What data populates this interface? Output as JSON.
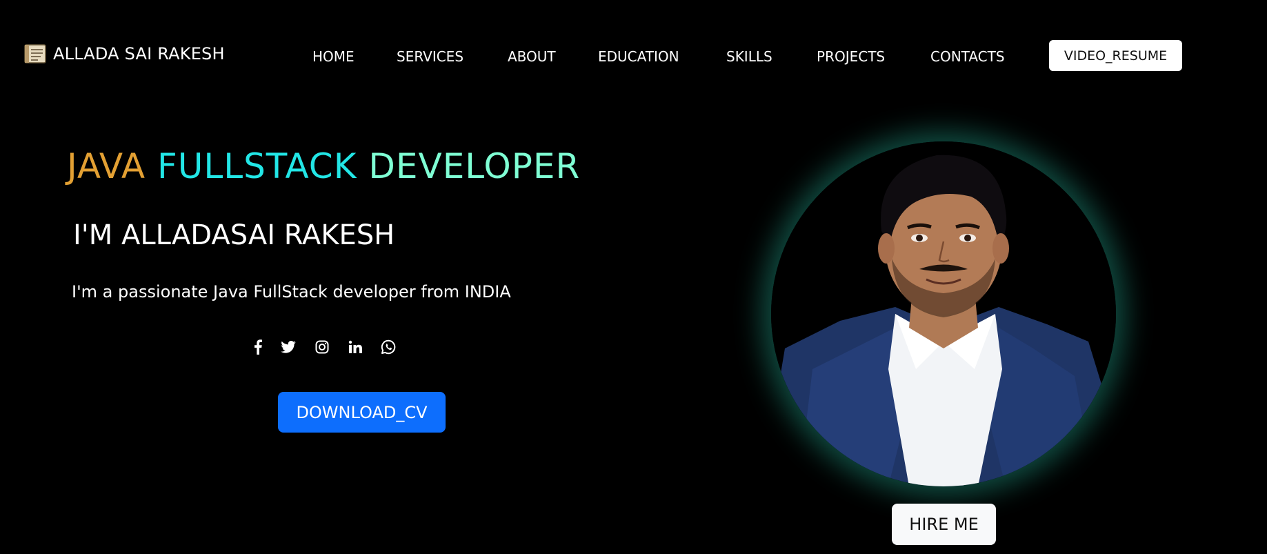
{
  "navbar": {
    "brand": {
      "logo_icon": "notebook-icon",
      "name": "ALLADA SAI RAKESH"
    },
    "links": [
      {
        "label": "HOME"
      },
      {
        "label": "SERVICES"
      },
      {
        "label": "ABOUT"
      },
      {
        "label": "EDUCATION"
      },
      {
        "label": "SKILLS"
      },
      {
        "label": "PROJECTS"
      },
      {
        "label": "CONTACTS"
      }
    ],
    "resume_button": "VIDEO_RESUME"
  },
  "hero": {
    "title_words": [
      "JAVA",
      "FULLSTACK",
      "DEVELOPER"
    ],
    "title_colors": [
      "#e3a033",
      "#22e6e6",
      "#7fffd4"
    ],
    "name": "I'M ALLADASAI RAKESH",
    "description": "I'm a passionate Java FullStack developer from INDIA",
    "socials": [
      {
        "icon": "facebook-icon"
      },
      {
        "icon": "twitter-icon"
      },
      {
        "icon": "instagram-icon"
      },
      {
        "icon": "linkedin-icon"
      },
      {
        "icon": "whatsapp-icon"
      }
    ],
    "download_button": "DOWNLOAD_CV",
    "hire_button": "HIRE ME"
  },
  "colors": {
    "background": "#000000",
    "primary_button": "#0d6efd",
    "avatar_glow": "#1e8c78"
  }
}
